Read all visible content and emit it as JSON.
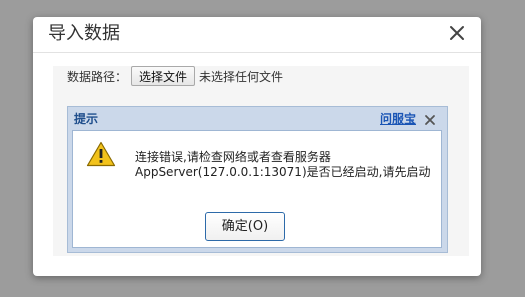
{
  "dialog": {
    "title": "导入数据",
    "close_icon": "close-icon"
  },
  "form": {
    "path_label": "数据路径：",
    "file_button_label": "选择文件",
    "file_status": "未选择任何文件"
  },
  "alert": {
    "title": "提示",
    "link": "问服宝",
    "close_icon": "close-icon",
    "icon": "warning-icon",
    "message_line1": "连接错误,请检查网络或者查看服务器",
    "message_line2": "AppServer(127.0.0.1:13071)是否已经启动,请先启动",
    "ok_label": "确定(O)"
  },
  "colors": {
    "overlay": "#9c9c9c",
    "alert_frame": "#cbd8ea",
    "alert_title": "#1f4e8c",
    "link": "#1a55b5",
    "ok_border": "#2d6aa9",
    "warning": "#f2c21b"
  }
}
